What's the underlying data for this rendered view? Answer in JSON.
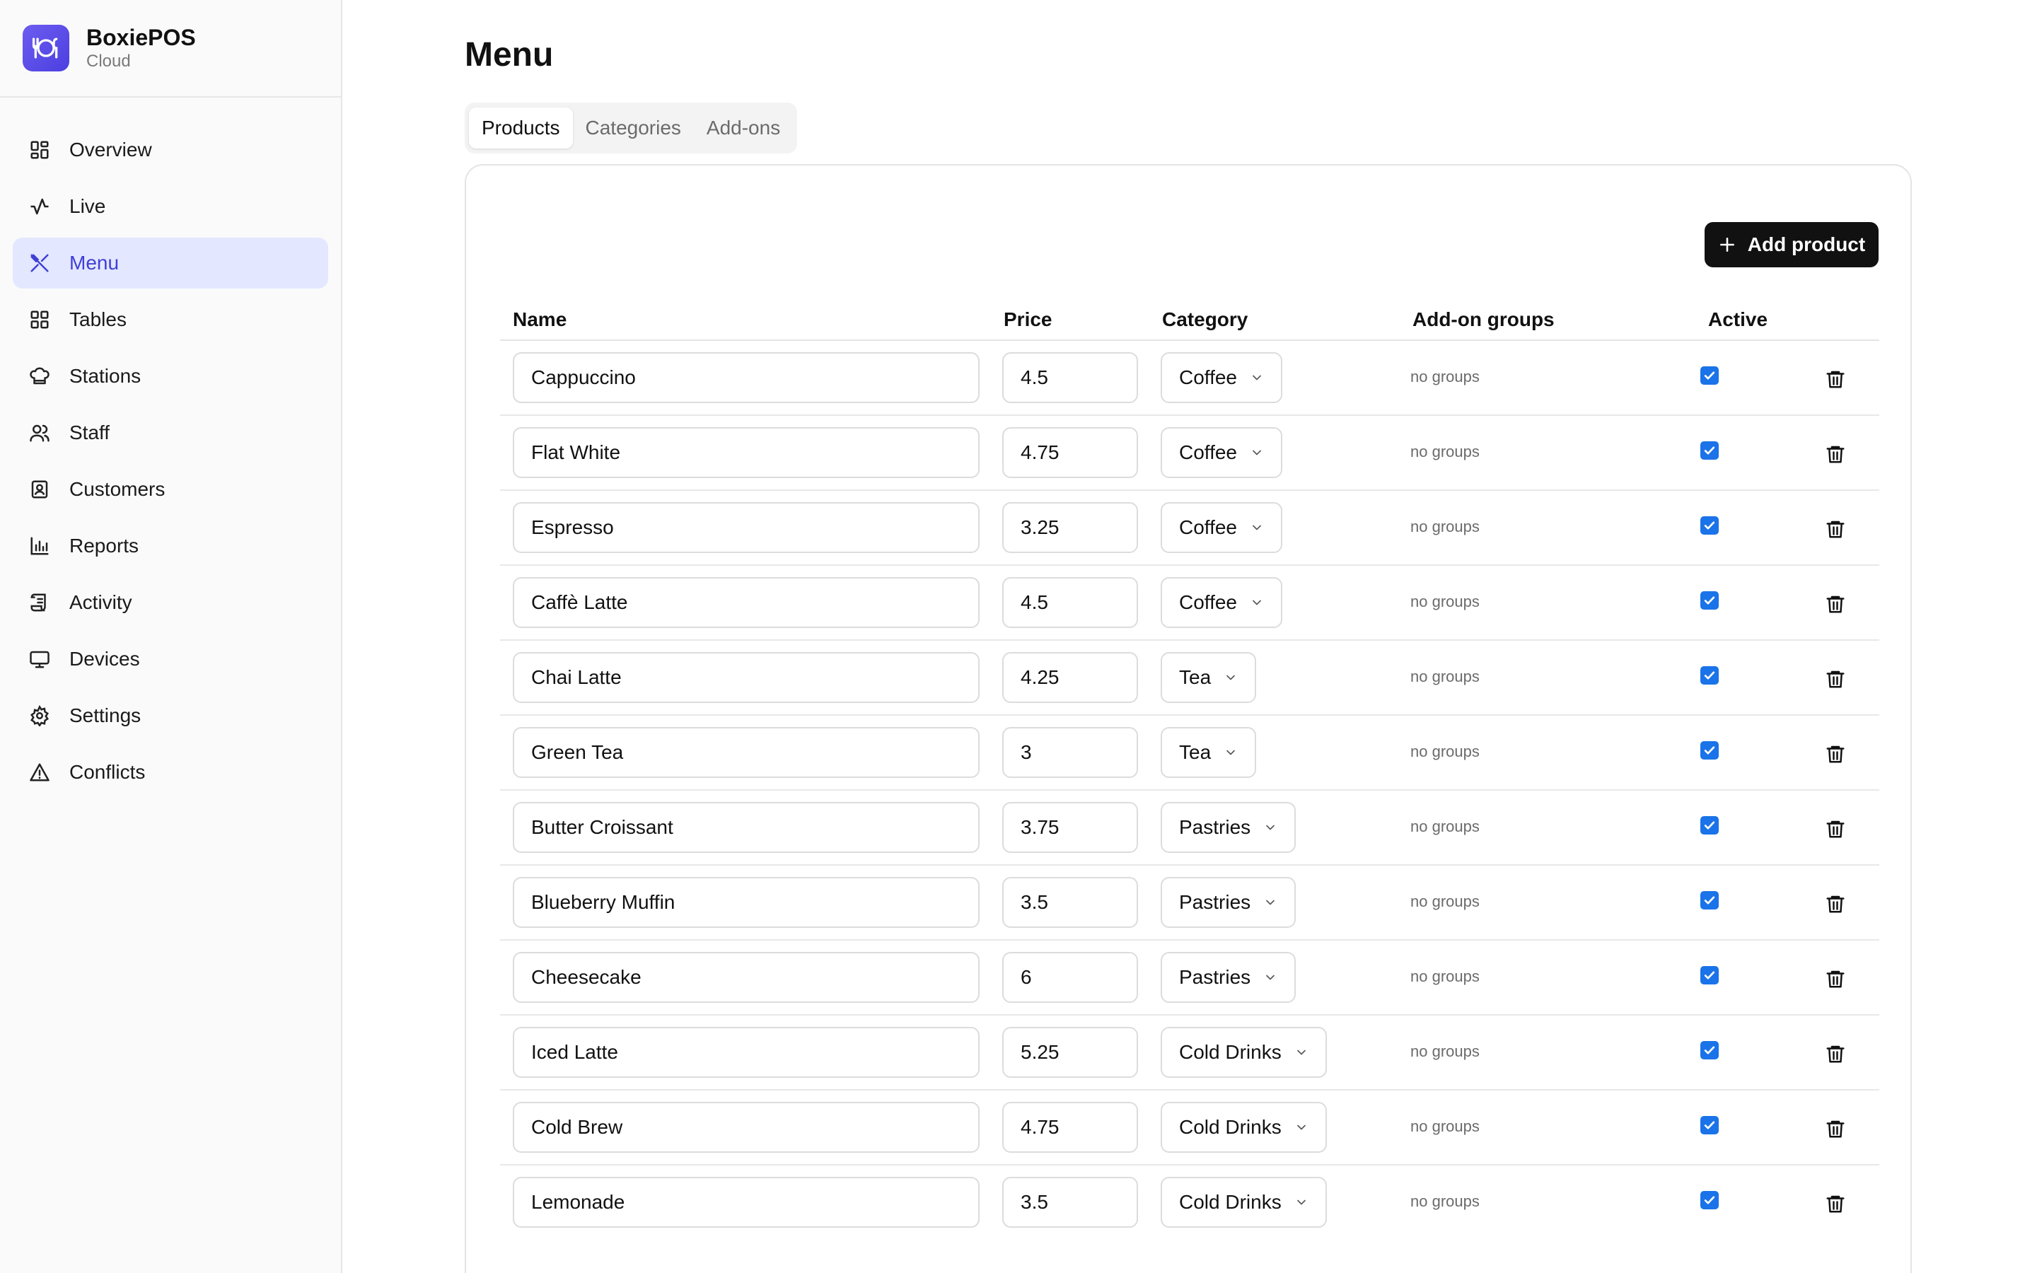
{
  "brand": {
    "name": "BoxiePOS",
    "subtitle": "Cloud"
  },
  "nav": [
    {
      "label": "Overview",
      "icon": "overview-grid-icon"
    },
    {
      "label": "Live",
      "icon": "activity-pulse-icon"
    },
    {
      "label": "Menu",
      "icon": "utensils-icon",
      "active": true
    },
    {
      "label": "Tables",
      "icon": "tables-grid-icon"
    },
    {
      "label": "Stations",
      "icon": "chef-hat-icon"
    },
    {
      "label": "Staff",
      "icon": "users-icon"
    },
    {
      "label": "Customers",
      "icon": "contact-card-icon"
    },
    {
      "label": "Reports",
      "icon": "bar-chart-icon"
    },
    {
      "label": "Activity",
      "icon": "scroll-icon"
    },
    {
      "label": "Devices",
      "icon": "monitor-icon"
    },
    {
      "label": "Settings",
      "icon": "gear-icon"
    },
    {
      "label": "Conflicts",
      "icon": "warning-triangle-icon"
    }
  ],
  "page": {
    "title": "Menu"
  },
  "tabs": [
    {
      "label": "Products",
      "active": true
    },
    {
      "label": "Categories"
    },
    {
      "label": "Add-ons"
    }
  ],
  "toolbar": {
    "add_label": "Add product"
  },
  "table": {
    "columns": [
      "Name",
      "Price",
      "Category",
      "Add-on groups",
      "Active"
    ],
    "rows": [
      {
        "name": "Cappuccino",
        "price": "4.5",
        "category": "Coffee",
        "groups": "no groups",
        "active": true
      },
      {
        "name": "Flat White",
        "price": "4.75",
        "category": "Coffee",
        "groups": "no groups",
        "active": true
      },
      {
        "name": "Espresso",
        "price": "3.25",
        "category": "Coffee",
        "groups": "no groups",
        "active": true
      },
      {
        "name": "Caffè Latte",
        "price": "4.5",
        "category": "Coffee",
        "groups": "no groups",
        "active": true
      },
      {
        "name": "Chai Latte",
        "price": "4.25",
        "category": "Tea",
        "groups": "no groups",
        "active": true
      },
      {
        "name": "Green Tea",
        "price": "3",
        "category": "Tea",
        "groups": "no groups",
        "active": true
      },
      {
        "name": "Butter Croissant",
        "price": "3.75",
        "category": "Pastries",
        "groups": "no groups",
        "active": true
      },
      {
        "name": "Blueberry Muffin",
        "price": "3.5",
        "category": "Pastries",
        "groups": "no groups",
        "active": true
      },
      {
        "name": "Cheesecake",
        "price": "6",
        "category": "Pastries",
        "groups": "no groups",
        "active": true
      },
      {
        "name": "Iced Latte",
        "price": "5.25",
        "category": "Cold Drinks",
        "groups": "no groups",
        "active": true
      },
      {
        "name": "Cold Brew",
        "price": "4.75",
        "category": "Cold Drinks",
        "groups": "no groups",
        "active": true
      },
      {
        "name": "Lemonade",
        "price": "3.5",
        "category": "Cold Drinks",
        "groups": "no groups",
        "active": true
      }
    ]
  },
  "colors": {
    "accent": "#3f3fd6",
    "active_nav_bg": "#e3e7ff",
    "checkbox": "#1a73e8",
    "brand_logo": "#5b4cea"
  }
}
